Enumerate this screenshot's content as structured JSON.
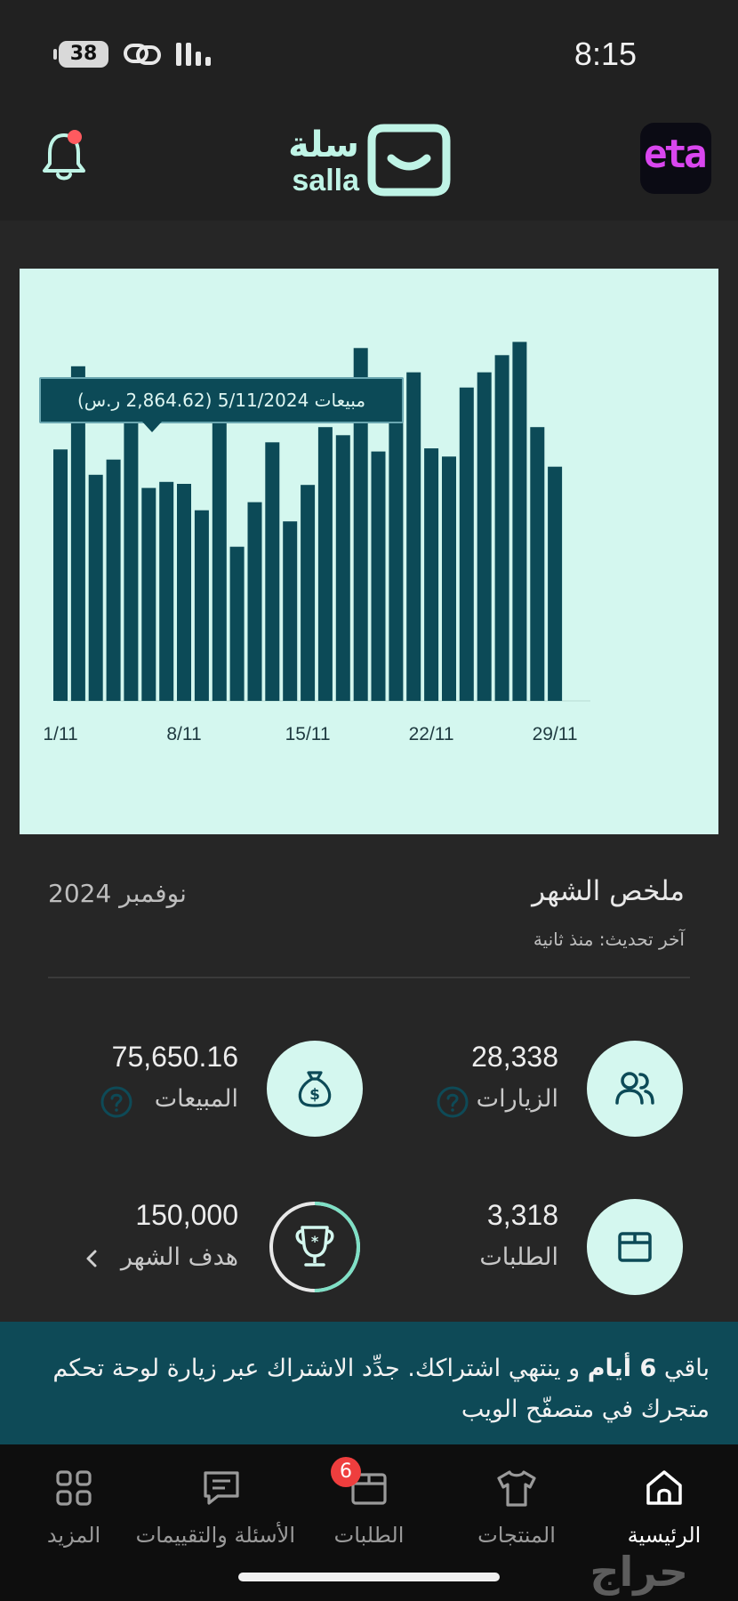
{
  "status_bar": {
    "battery": "38",
    "time": "8:15"
  },
  "header": {
    "logo_ar": "سلة",
    "logo_en": "salla",
    "store_initials": "eta"
  },
  "chart_data": {
    "type": "bar",
    "series_label": "مبيعات",
    "tick_labels": [
      "1/11",
      "8/11",
      "15/11",
      "22/11",
      "29/11"
    ],
    "tick_indices": [
      0,
      7,
      14,
      21,
      28
    ],
    "days": [
      "1/11",
      "2/11",
      "3/11",
      "4/11",
      "5/11",
      "6/11",
      "7/11",
      "8/11",
      "9/11",
      "10/11",
      "11/11",
      "12/11",
      "13/11",
      "14/11",
      "15/11",
      "16/11",
      "17/11",
      "18/11",
      "19/11",
      "20/11",
      "21/11",
      "22/11",
      "23/11",
      "24/11",
      "25/11",
      "26/11",
      "27/11",
      "28/11",
      "29/11",
      "30/11"
    ],
    "values": [
      2480,
      3300,
      2230,
      2380,
      2864.62,
      2100,
      2160,
      2140,
      1880,
      2830,
      1520,
      1960,
      2550,
      1770,
      2130,
      2700,
      2620,
      3480,
      2460,
      3090,
      3240,
      2490,
      2410,
      3090,
      3240,
      3410,
      3540,
      2700,
      2310,
      0
    ],
    "ylim": [
      0,
      4000
    ],
    "grid": false,
    "bar_color": "#0c4a57",
    "tooltip": {
      "index": 4,
      "date": "5/11/2024",
      "value": "2,864.62",
      "currency": "ر.س",
      "text": "مبيعات 5/11/2024 (2,864.62 ر.س)"
    }
  },
  "summary": {
    "title": "ملخص الشهر",
    "month": "نوفمبر 2024",
    "updated": "آخر تحديث: منذ ثانية",
    "visits": {
      "value": "28,338",
      "label": "الزيارات"
    },
    "sales": {
      "value": "75,650.16",
      "label": "المبيعات"
    },
    "orders": {
      "value": "3,318",
      "label": "الطلبات"
    },
    "goal": {
      "value": "150,000",
      "label": "هدف الشهر",
      "progress": 0.5
    }
  },
  "banner": {
    "part1": "باقي ",
    "days_bold": "6 أيام",
    "part2": " و ينتهي اشتراكك. جدِّد الاشتراك عبر زيارة لوحة تحكم متجرك في متصفّح الويب"
  },
  "nav": {
    "home": "الرئيسية",
    "products": "المنتجات",
    "orders": "الطلبات",
    "orders_badge": "6",
    "reviews": "الأسئلة والتقييمات",
    "more": "المزيد"
  },
  "watermark": "حراج",
  "colors": {
    "accent": "#d4f7ef",
    "brand_dark": "#0e4a57",
    "badge": "#ef3e3e"
  }
}
